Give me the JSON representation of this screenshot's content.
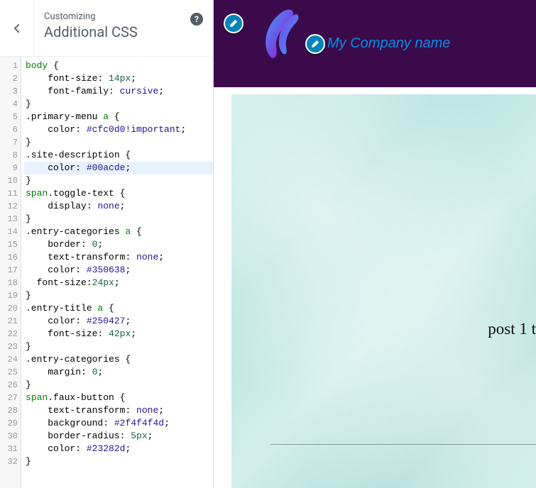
{
  "header": {
    "subtitle": "Customizing",
    "title": "Additional CSS",
    "help_tooltip": "?"
  },
  "editor": {
    "active_line_index": 8,
    "lines": [
      {
        "n": 1,
        "segs": [
          [
            "tag",
            "body"
          ],
          [
            "punct",
            " {"
          ]
        ]
      },
      {
        "n": 2,
        "segs": [
          [
            "punct",
            "    "
          ],
          [
            "prop",
            "font-size"
          ],
          [
            "punct",
            ": "
          ],
          [
            "num",
            "14px"
          ],
          [
            "punct",
            ";"
          ]
        ]
      },
      {
        "n": 3,
        "segs": [
          [
            "punct",
            "    "
          ],
          [
            "prop",
            "font-family"
          ],
          [
            "punct",
            ": "
          ],
          [
            "atom",
            "cursive"
          ],
          [
            "punct",
            ";"
          ]
        ]
      },
      {
        "n": 4,
        "segs": [
          [
            "punct",
            "}"
          ]
        ]
      },
      {
        "n": 5,
        "segs": [
          [
            "qual",
            ".primary-menu "
          ],
          [
            "tag",
            "a"
          ],
          [
            "punct",
            " {"
          ]
        ]
      },
      {
        "n": 6,
        "segs": [
          [
            "punct",
            "    "
          ],
          [
            "prop",
            "color"
          ],
          [
            "punct",
            ": "
          ],
          [
            "hex",
            "#cfc0d0"
          ],
          [
            "atom",
            "!important"
          ],
          [
            "punct",
            ";"
          ]
        ]
      },
      {
        "n": 7,
        "segs": [
          [
            "punct",
            "}"
          ]
        ]
      },
      {
        "n": 8,
        "segs": [
          [
            "qual",
            ".site-description"
          ],
          [
            "punct",
            " {"
          ]
        ]
      },
      {
        "n": 9,
        "segs": [
          [
            "punct",
            "    "
          ],
          [
            "prop",
            "color"
          ],
          [
            "punct",
            ": "
          ],
          [
            "hex",
            "#00acde"
          ],
          [
            "punct",
            ";"
          ]
        ]
      },
      {
        "n": 10,
        "segs": [
          [
            "punct",
            "}"
          ]
        ]
      },
      {
        "n": 11,
        "segs": [
          [
            "tag",
            "span"
          ],
          [
            "qual",
            ".toggle-text"
          ],
          [
            "punct",
            " {"
          ]
        ]
      },
      {
        "n": 12,
        "segs": [
          [
            "punct",
            "    "
          ],
          [
            "prop",
            "display"
          ],
          [
            "punct",
            ": "
          ],
          [
            "atom",
            "none"
          ],
          [
            "punct",
            ";"
          ]
        ]
      },
      {
        "n": 13,
        "segs": [
          [
            "punct",
            "}"
          ]
        ]
      },
      {
        "n": 14,
        "segs": [
          [
            "qual",
            ".entry-categories "
          ],
          [
            "tag",
            "a"
          ],
          [
            "punct",
            " {"
          ]
        ]
      },
      {
        "n": 15,
        "segs": [
          [
            "punct",
            "    "
          ],
          [
            "prop",
            "border"
          ],
          [
            "punct",
            ": "
          ],
          [
            "num",
            "0"
          ],
          [
            "punct",
            ";"
          ]
        ]
      },
      {
        "n": 16,
        "segs": [
          [
            "punct",
            "    "
          ],
          [
            "prop",
            "text-transform"
          ],
          [
            "punct",
            ": "
          ],
          [
            "atom",
            "none"
          ],
          [
            "punct",
            ";"
          ]
        ]
      },
      {
        "n": 17,
        "segs": [
          [
            "punct",
            "    "
          ],
          [
            "prop",
            "color"
          ],
          [
            "punct",
            ": "
          ],
          [
            "hex",
            "#350638"
          ],
          [
            "punct",
            ";"
          ]
        ]
      },
      {
        "n": 18,
        "segs": [
          [
            "punct",
            "  "
          ],
          [
            "prop",
            "font-size"
          ],
          [
            "punct",
            ":"
          ],
          [
            "num",
            "24px"
          ],
          [
            "punct",
            ";"
          ]
        ]
      },
      {
        "n": 19,
        "segs": [
          [
            "punct",
            "}"
          ]
        ]
      },
      {
        "n": 20,
        "segs": [
          [
            "qual",
            ".entry-title "
          ],
          [
            "tag",
            "a"
          ],
          [
            "punct",
            " {"
          ]
        ]
      },
      {
        "n": 21,
        "segs": [
          [
            "punct",
            "    "
          ],
          [
            "prop",
            "color"
          ],
          [
            "punct",
            ": "
          ],
          [
            "hex",
            "#250427"
          ],
          [
            "punct",
            ";"
          ]
        ]
      },
      {
        "n": 22,
        "segs": [
          [
            "punct",
            "    "
          ],
          [
            "prop",
            "font-size"
          ],
          [
            "punct",
            ": "
          ],
          [
            "num",
            "42px"
          ],
          [
            "punct",
            ";"
          ]
        ]
      },
      {
        "n": 23,
        "segs": [
          [
            "punct",
            "}"
          ]
        ]
      },
      {
        "n": 24,
        "segs": [
          [
            "qual",
            ".entry-categories"
          ],
          [
            "punct",
            " {"
          ]
        ]
      },
      {
        "n": 25,
        "segs": [
          [
            "punct",
            "    "
          ],
          [
            "prop",
            "margin"
          ],
          [
            "punct",
            ": "
          ],
          [
            "num",
            "0"
          ],
          [
            "punct",
            ";"
          ]
        ]
      },
      {
        "n": 26,
        "segs": [
          [
            "punct",
            "}"
          ]
        ]
      },
      {
        "n": 27,
        "segs": [
          [
            "tag",
            "span"
          ],
          [
            "qual",
            ".faux-button"
          ],
          [
            "punct",
            " {"
          ]
        ]
      },
      {
        "n": 28,
        "segs": [
          [
            "punct",
            "    "
          ],
          [
            "prop",
            "text-transform"
          ],
          [
            "punct",
            ": "
          ],
          [
            "atom",
            "none"
          ],
          [
            "punct",
            ";"
          ]
        ]
      },
      {
        "n": 29,
        "segs": [
          [
            "punct",
            "    "
          ],
          [
            "prop",
            "background"
          ],
          [
            "punct",
            ": "
          ],
          [
            "hex",
            "#2f4f4f4d"
          ],
          [
            "punct",
            ";"
          ]
        ]
      },
      {
        "n": 30,
        "segs": [
          [
            "punct",
            "    "
          ],
          [
            "prop",
            "border-radius"
          ],
          [
            "punct",
            ": "
          ],
          [
            "num",
            "5px"
          ],
          [
            "punct",
            ";"
          ]
        ]
      },
      {
        "n": 31,
        "segs": [
          [
            "punct",
            "    "
          ],
          [
            "prop",
            "color"
          ],
          [
            "punct",
            ": "
          ],
          [
            "hex",
            "#23282d"
          ],
          [
            "punct",
            ";"
          ]
        ]
      },
      {
        "n": 32,
        "segs": [
          [
            "punct",
            "}"
          ]
        ]
      }
    ]
  },
  "preview": {
    "site_name": "My Company name",
    "post_title_fragment": "post 1 t"
  }
}
